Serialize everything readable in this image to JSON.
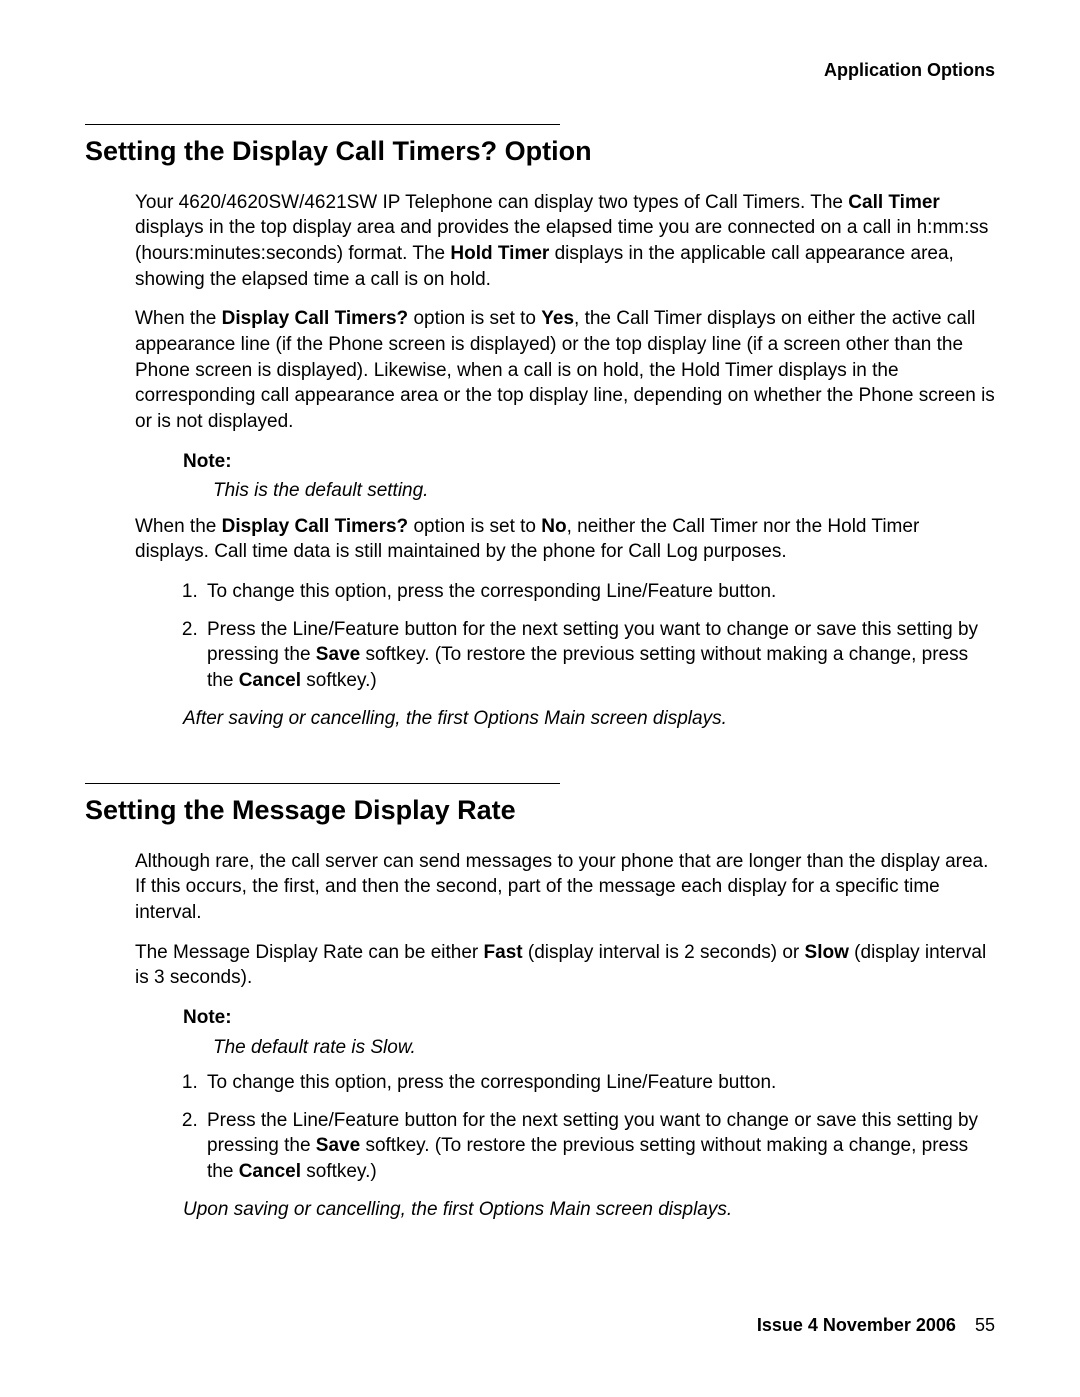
{
  "header": {
    "running": "Application Options"
  },
  "section1": {
    "title": "Setting the Display Call Timers? Option",
    "p1_a": "Your 4620/4620SW/4621SW IP Telephone can display two types of Call Timers. The ",
    "p1_b1": "Call Timer",
    "p1_c": " displays in the top display area and provides the elapsed time you are connected on a call in h:mm:ss (hours:minutes:seconds) format. The ",
    "p1_b2": "Hold Timer",
    "p1_d": " displays in the applicable call appearance area, showing the elapsed time a call is on hold.",
    "p2_a": "When the ",
    "p2_b1": "Display Call Timers?",
    "p2_c": " option is set to ",
    "p2_b2": "Yes",
    "p2_d": ", the Call Timer displays on either the active call appearance line (if the Phone screen is displayed) or the top display line (if a screen other than the Phone screen is displayed). Likewise, when a call is on hold, the Hold Timer displays in the corresponding call appearance area or the top display line, depending on whether the Phone screen is or is not displayed.",
    "note_label": "Note:",
    "note_body": "This is the default setting.",
    "p3_a": "When the ",
    "p3_b1": "Display Call Timers?",
    "p3_c": " option is set to ",
    "p3_b2": "No",
    "p3_d": ", neither the Call Timer nor the Hold Timer displays. Call time data is still maintained by the phone for Call Log purposes.",
    "li1": "To change this option, press the corresponding Line/Feature button.",
    "li2_a": "Press the Line/Feature button for the next setting you want to change or save this setting by pressing the ",
    "li2_b1": "Save",
    "li2_c": " softkey. (To restore the previous setting without making a change, press the ",
    "li2_b2": "Cancel",
    "li2_d": " softkey.)",
    "after": "After saving or cancelling, the first Options Main screen displays."
  },
  "section2": {
    "title": "Setting the Message Display Rate",
    "p1": "Although rare, the call server can send messages to your phone that are longer than the display area. If this occurs, the first, and then the second, part of the message each display for a specific time interval.",
    "p2_a": "The Message Display Rate can be either ",
    "p2_b1": "Fast",
    "p2_c": " (display interval is 2 seconds) or ",
    "p2_b2": "Slow",
    "p2_d": " (display interval is 3 seconds).",
    "note_label": "Note:",
    "note_body": "The default rate is Slow.",
    "li1": "To change this option, press the corresponding Line/Feature button.",
    "li2_a": "Press the Line/Feature button for the next setting you want to change or save this setting by pressing the ",
    "li2_b1": "Save",
    "li2_c": " softkey. (To restore the previous setting without making a change, press the ",
    "li2_b2": "Cancel",
    "li2_d": " softkey.)",
    "after": "Upon saving or cancelling, the first Options Main screen displays."
  },
  "footer": {
    "issue": "Issue 4   November 2006",
    "page": "55"
  }
}
